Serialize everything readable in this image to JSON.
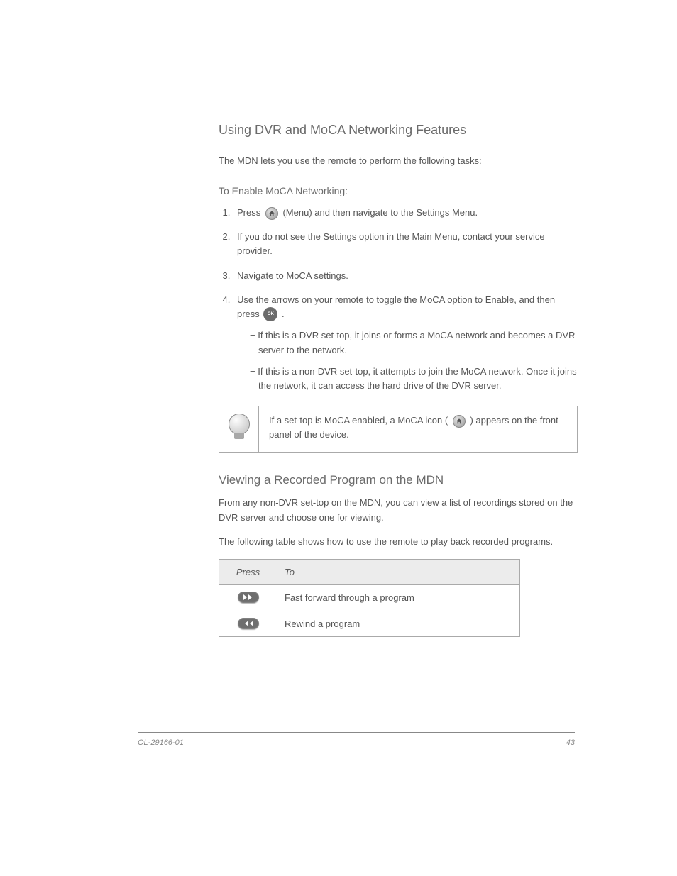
{
  "header": "Using DVR and MoCA Networking Features",
  "intro": "The MDN lets you use the remote to perform the following tasks:",
  "section_title_1": "To Enable MoCA Networking:",
  "steps": [
    {
      "text_pre": "Press ",
      "text_post": " (Menu) and then navigate to the Settings Menu."
    },
    {
      "full": "If you do not see the Settings option in the Main Menu, contact your service provider."
    },
    {
      "full": "Navigate to MoCA settings."
    },
    {
      "text_pre": "Use the arrows on your remote to toggle the MoCA option to Enable, and then press ",
      "text_post": ".",
      "subitems": [
        "If this is a DVR set-top, it joins or forms a MoCA network and becomes a DVR server to the network.",
        "If this is a non-DVR set-top, it attempts to join the MoCA network. Once it joins the network, it can access the hard drive of the DVR server."
      ]
    }
  ],
  "ok_label": "OK",
  "tip": {
    "text_pre": "If a set-top is MoCA enabled, a MoCA icon (",
    "text_post": ") appears on the front panel of the device."
  },
  "section_title_2": "Viewing a Recorded Program on the MDN",
  "body2": "From any non-DVR set-top on the MDN, you can view a list of recordings stored on the DVR server and choose one for viewing.",
  "body3": "The following table shows how to use the remote to play back recorded programs.",
  "table": {
    "headers": [
      "Press",
      "To"
    ],
    "rows": [
      {
        "label": "Fast forward through a program"
      },
      {
        "label": "Rewind a program"
      }
    ]
  },
  "footer": {
    "left": "OL-29166-01",
    "right": "43"
  }
}
